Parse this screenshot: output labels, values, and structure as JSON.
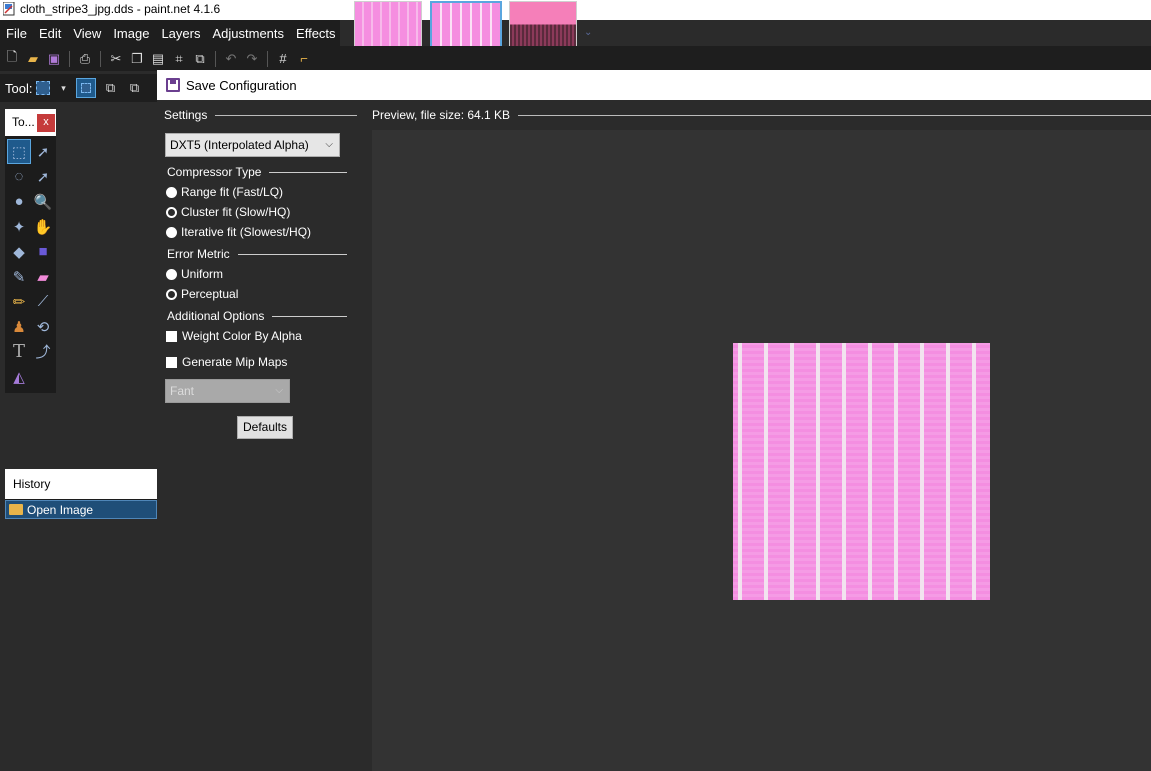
{
  "window": {
    "title": "cloth_stripe3_jpg.dds - paint.net 4.1.6"
  },
  "menu": {
    "items": [
      "File",
      "Edit",
      "View",
      "Image",
      "Layers",
      "Adjustments",
      "Effects"
    ]
  },
  "toolbar": {
    "tool_label": "Tool:"
  },
  "tools_panel": {
    "title": "To...",
    "close_label": "x",
    "tools": [
      {
        "name": "rectangle-select-icon",
        "glyph": "⬚",
        "active": true
      },
      {
        "name": "move-selected-icon",
        "glyph": "➚"
      },
      {
        "name": "lasso-select-icon",
        "glyph": "◌"
      },
      {
        "name": "move-selection-icon",
        "glyph": "➚"
      },
      {
        "name": "ellipse-select-icon",
        "glyph": "●"
      },
      {
        "name": "zoom-icon",
        "glyph": "🔍"
      },
      {
        "name": "magic-wand-icon",
        "glyph": "✦"
      },
      {
        "name": "pan-icon",
        "glyph": "✋"
      },
      {
        "name": "paint-bucket-icon",
        "glyph": "◆"
      },
      {
        "name": "gradient-icon",
        "glyph": "■"
      },
      {
        "name": "paintbrush-icon",
        "glyph": "✎"
      },
      {
        "name": "eraser-icon",
        "glyph": "▰"
      },
      {
        "name": "pencil-icon",
        "glyph": "✏"
      },
      {
        "name": "color-picker-icon",
        "glyph": "⟋"
      },
      {
        "name": "clone-stamp-icon",
        "glyph": "♟"
      },
      {
        "name": "recolor-icon",
        "glyph": "⟲"
      },
      {
        "name": "text-icon",
        "glyph": "T"
      },
      {
        "name": "line-curve-icon",
        "glyph": "⤴"
      },
      {
        "name": "shapes-icon",
        "glyph": "◭"
      }
    ]
  },
  "history_panel": {
    "title": "History",
    "items": [
      "Open Image"
    ]
  },
  "dialog": {
    "title": "Save Configuration",
    "settings_label": "Settings",
    "preview_label": "Preview, file size: 64.1 KB",
    "format_selected": "DXT5 (Interpolated Alpha)",
    "compressor_type": {
      "label": "Compressor Type",
      "options": [
        "Range fit (Fast/LQ)",
        "Cluster fit (Slow/HQ)",
        "Iterative fit (Slowest/HQ)"
      ],
      "selected_index": 1
    },
    "error_metric": {
      "label": "Error Metric",
      "options": [
        "Uniform",
        "Perceptual"
      ],
      "selected_index": 1
    },
    "additional_options": {
      "label": "Additional Options",
      "weight_color_by_alpha": "Weight Color By Alpha",
      "generate_mip_maps": "Generate Mip Maps",
      "mip_filter_selected": "Fant"
    },
    "defaults_label": "Defaults"
  },
  "colors": {
    "accent": "#1f5a8c",
    "preview_pink": "#f48ee1",
    "close_red": "#c53b3b"
  }
}
